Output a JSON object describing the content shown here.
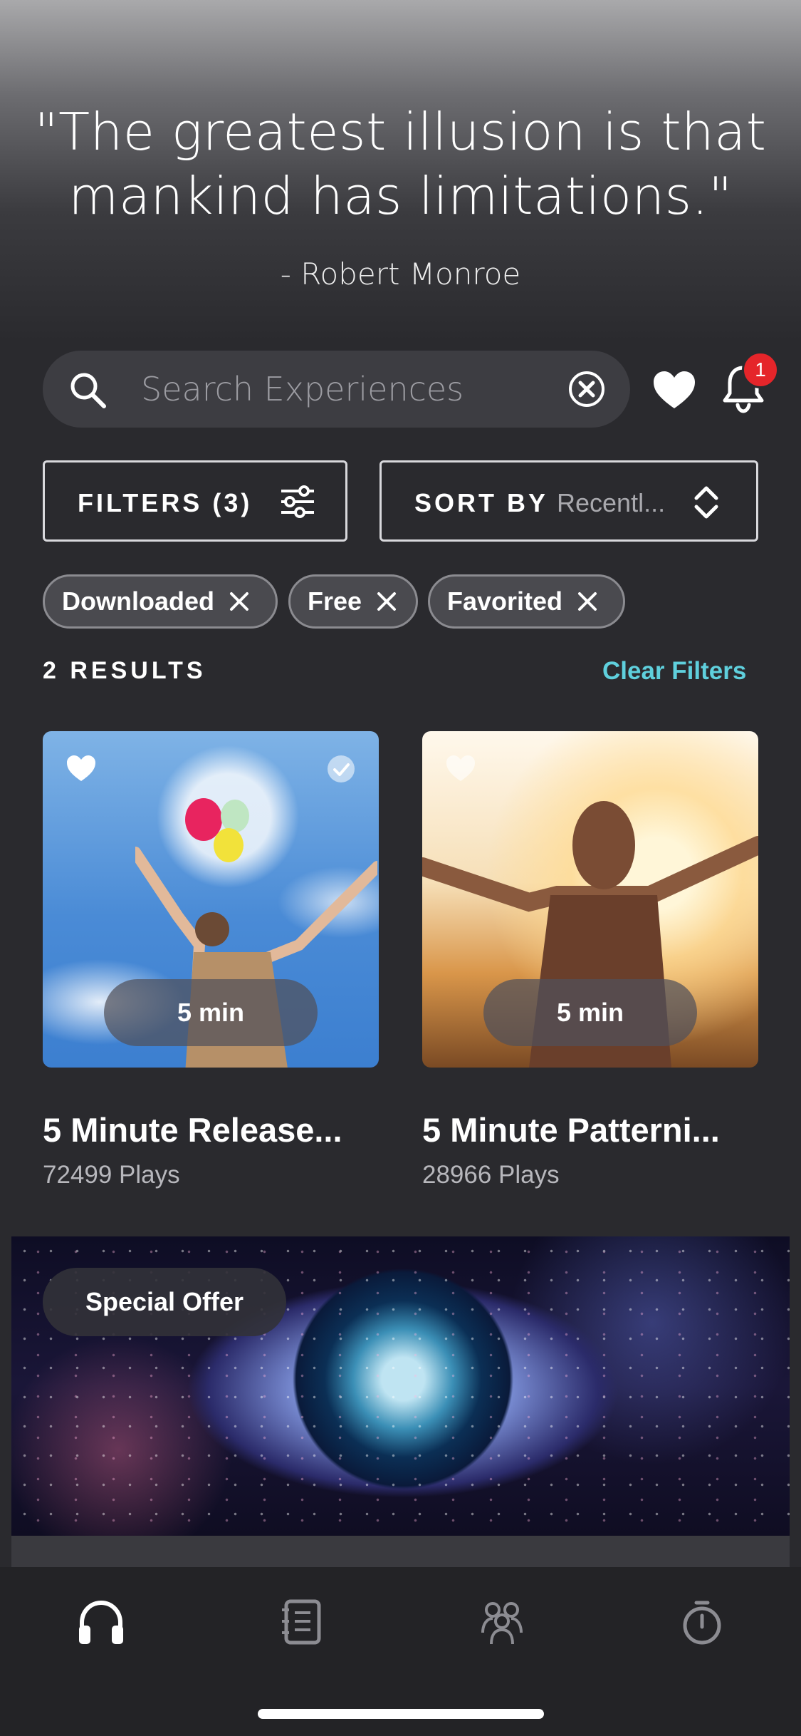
{
  "quote": {
    "text": "\"The greatest illusion is that mankind has limitations.\"",
    "author": "- Robert Monroe"
  },
  "search": {
    "placeholder": "Search Experiences",
    "value": ""
  },
  "notifications": {
    "badge_count": "1"
  },
  "filters": {
    "label": "FILTERS (3)",
    "sort_label": "SORT BY",
    "sort_value": "Recentl..."
  },
  "chips": [
    {
      "label": "Downloaded"
    },
    {
      "label": "Free"
    },
    {
      "label": "Favorited"
    }
  ],
  "results": {
    "count_label": "2 RESULTS",
    "clear_label": "Clear Filters"
  },
  "cards": [
    {
      "title": "5 Minute Release...",
      "plays": "72499 Plays",
      "duration": "5 min"
    },
    {
      "title": "5 Minute Patterni...",
      "plays": "28966 Plays",
      "duration": "5 min"
    }
  ],
  "banner": {
    "label": "Special Offer"
  },
  "tabs": [
    {
      "icon": "headphones-icon",
      "active": true
    },
    {
      "icon": "journal-icon",
      "active": false
    },
    {
      "icon": "community-icon",
      "active": false
    },
    {
      "icon": "timer-icon",
      "active": false
    }
  ],
  "colors": {
    "background": "#2a2a2e",
    "accent": "#5fd0dd",
    "badge": "#e5252a",
    "tab_inactive": "#8c8c92"
  }
}
